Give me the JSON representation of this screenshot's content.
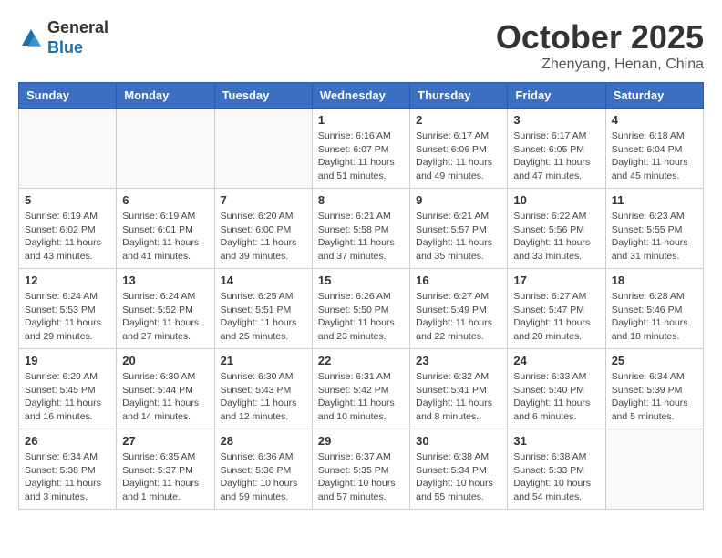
{
  "header": {
    "logo_line1": "General",
    "logo_line2": "Blue",
    "month_title": "October 2025",
    "location": "Zhenyang, Henan, China"
  },
  "weekdays": [
    "Sunday",
    "Monday",
    "Tuesday",
    "Wednesday",
    "Thursday",
    "Friday",
    "Saturday"
  ],
  "weeks": [
    [
      {
        "day": "",
        "info": ""
      },
      {
        "day": "",
        "info": ""
      },
      {
        "day": "",
        "info": ""
      },
      {
        "day": "1",
        "info": "Sunrise: 6:16 AM\nSunset: 6:07 PM\nDaylight: 11 hours\nand 51 minutes."
      },
      {
        "day": "2",
        "info": "Sunrise: 6:17 AM\nSunset: 6:06 PM\nDaylight: 11 hours\nand 49 minutes."
      },
      {
        "day": "3",
        "info": "Sunrise: 6:17 AM\nSunset: 6:05 PM\nDaylight: 11 hours\nand 47 minutes."
      },
      {
        "day": "4",
        "info": "Sunrise: 6:18 AM\nSunset: 6:04 PM\nDaylight: 11 hours\nand 45 minutes."
      }
    ],
    [
      {
        "day": "5",
        "info": "Sunrise: 6:19 AM\nSunset: 6:02 PM\nDaylight: 11 hours\nand 43 minutes."
      },
      {
        "day": "6",
        "info": "Sunrise: 6:19 AM\nSunset: 6:01 PM\nDaylight: 11 hours\nand 41 minutes."
      },
      {
        "day": "7",
        "info": "Sunrise: 6:20 AM\nSunset: 6:00 PM\nDaylight: 11 hours\nand 39 minutes."
      },
      {
        "day": "8",
        "info": "Sunrise: 6:21 AM\nSunset: 5:58 PM\nDaylight: 11 hours\nand 37 minutes."
      },
      {
        "day": "9",
        "info": "Sunrise: 6:21 AM\nSunset: 5:57 PM\nDaylight: 11 hours\nand 35 minutes."
      },
      {
        "day": "10",
        "info": "Sunrise: 6:22 AM\nSunset: 5:56 PM\nDaylight: 11 hours\nand 33 minutes."
      },
      {
        "day": "11",
        "info": "Sunrise: 6:23 AM\nSunset: 5:55 PM\nDaylight: 11 hours\nand 31 minutes."
      }
    ],
    [
      {
        "day": "12",
        "info": "Sunrise: 6:24 AM\nSunset: 5:53 PM\nDaylight: 11 hours\nand 29 minutes."
      },
      {
        "day": "13",
        "info": "Sunrise: 6:24 AM\nSunset: 5:52 PM\nDaylight: 11 hours\nand 27 minutes."
      },
      {
        "day": "14",
        "info": "Sunrise: 6:25 AM\nSunset: 5:51 PM\nDaylight: 11 hours\nand 25 minutes."
      },
      {
        "day": "15",
        "info": "Sunrise: 6:26 AM\nSunset: 5:50 PM\nDaylight: 11 hours\nand 23 minutes."
      },
      {
        "day": "16",
        "info": "Sunrise: 6:27 AM\nSunset: 5:49 PM\nDaylight: 11 hours\nand 22 minutes."
      },
      {
        "day": "17",
        "info": "Sunrise: 6:27 AM\nSunset: 5:47 PM\nDaylight: 11 hours\nand 20 minutes."
      },
      {
        "day": "18",
        "info": "Sunrise: 6:28 AM\nSunset: 5:46 PM\nDaylight: 11 hours\nand 18 minutes."
      }
    ],
    [
      {
        "day": "19",
        "info": "Sunrise: 6:29 AM\nSunset: 5:45 PM\nDaylight: 11 hours\nand 16 minutes."
      },
      {
        "day": "20",
        "info": "Sunrise: 6:30 AM\nSunset: 5:44 PM\nDaylight: 11 hours\nand 14 minutes."
      },
      {
        "day": "21",
        "info": "Sunrise: 6:30 AM\nSunset: 5:43 PM\nDaylight: 11 hours\nand 12 minutes."
      },
      {
        "day": "22",
        "info": "Sunrise: 6:31 AM\nSunset: 5:42 PM\nDaylight: 11 hours\nand 10 minutes."
      },
      {
        "day": "23",
        "info": "Sunrise: 6:32 AM\nSunset: 5:41 PM\nDaylight: 11 hours\nand 8 minutes."
      },
      {
        "day": "24",
        "info": "Sunrise: 6:33 AM\nSunset: 5:40 PM\nDaylight: 11 hours\nand 6 minutes."
      },
      {
        "day": "25",
        "info": "Sunrise: 6:34 AM\nSunset: 5:39 PM\nDaylight: 11 hours\nand 5 minutes."
      }
    ],
    [
      {
        "day": "26",
        "info": "Sunrise: 6:34 AM\nSunset: 5:38 PM\nDaylight: 11 hours\nand 3 minutes."
      },
      {
        "day": "27",
        "info": "Sunrise: 6:35 AM\nSunset: 5:37 PM\nDaylight: 11 hours\nand 1 minute."
      },
      {
        "day": "28",
        "info": "Sunrise: 6:36 AM\nSunset: 5:36 PM\nDaylight: 10 hours\nand 59 minutes."
      },
      {
        "day": "29",
        "info": "Sunrise: 6:37 AM\nSunset: 5:35 PM\nDaylight: 10 hours\nand 57 minutes."
      },
      {
        "day": "30",
        "info": "Sunrise: 6:38 AM\nSunset: 5:34 PM\nDaylight: 10 hours\nand 55 minutes."
      },
      {
        "day": "31",
        "info": "Sunrise: 6:38 AM\nSunset: 5:33 PM\nDaylight: 10 hours\nand 54 minutes."
      },
      {
        "day": "",
        "info": ""
      }
    ]
  ]
}
